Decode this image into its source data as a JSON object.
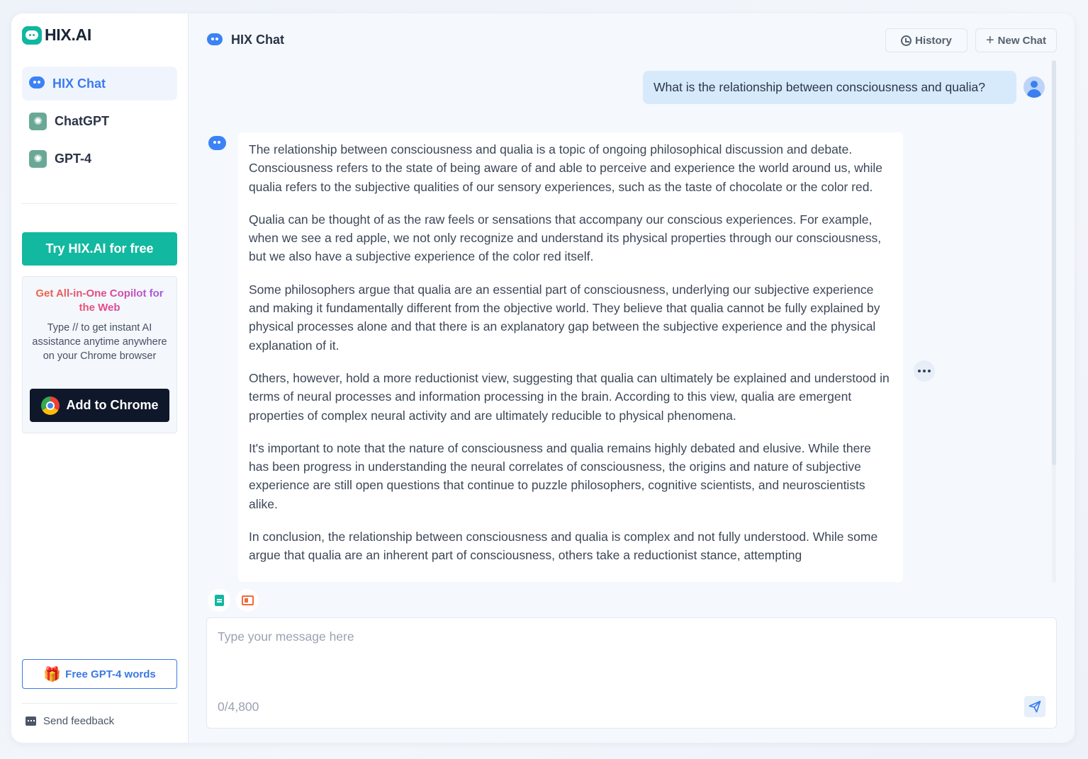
{
  "brand": {
    "name": "HIX.AI"
  },
  "sidebar": {
    "nav": [
      {
        "label": "HIX Chat",
        "icon": "chat-bubble-icon",
        "active": true
      },
      {
        "label": "ChatGPT",
        "icon": "openai-icon",
        "active": false
      },
      {
        "label": "GPT-4",
        "icon": "openai-icon",
        "active": false
      }
    ],
    "try_button": "Try HIX.AI for free",
    "promo": {
      "title": "Get All-in-One Copilot for the Web",
      "text": "Type // to get instant AI assistance anytime anywhere on your Chrome browser",
      "button": "Add to Chrome"
    },
    "free_words_button": "Free GPT-4 words",
    "feedback": "Send feedback"
  },
  "header": {
    "title": "HIX Chat",
    "history_label": "History",
    "new_chat_label": "New Chat"
  },
  "conversation": {
    "user_message": "What is the relationship between consciousness and qualia?",
    "answer_paragraphs": [
      "The relationship between consciousness and qualia is a topic of ongoing philosophical discussion and debate. Consciousness refers to the state of being aware of and able to perceive and experience the world around us, while qualia refers to the subjective qualities of our sensory experiences, such as the taste of chocolate or the color red.",
      "Qualia can be thought of as the raw feels or sensations that accompany our conscious experiences. For example, when we see a red apple, we not only recognize and understand its physical properties through our consciousness, but we also have a subjective experience of the color red itself.",
      "Some philosophers argue that qualia are an essential part of consciousness, underlying our subjective experience and making it fundamentally different from the objective world. They believe that qualia cannot be fully explained by physical processes alone and that there is an explanatory gap between the subjective experience and the physical explanation of it.",
      "Others, however, hold a more reductionist view, suggesting that qualia can ultimately be explained and understood in terms of neural processes and information processing in the brain. According to this view, qualia are emergent properties of complex neural activity and are ultimately reducible to physical phenomena.",
      "It's important to note that the nature of consciousness and qualia remains highly debated and elusive. While there has been progress in understanding the neural correlates of consciousness, the origins and nature of subjective experience are still open questions that continue to puzzle philosophers, cognitive scientists, and neuroscientists alike.",
      "In conclusion, the relationship between consciousness and qualia is complex and not fully understood. While some argue that qualia are an inherent part of consciousness, others take a reductionist stance, attempting"
    ]
  },
  "composer": {
    "placeholder": "Type your message here",
    "value": "",
    "counter": "0/4,800"
  },
  "colors": {
    "accent_teal": "#12b89f",
    "accent_blue": "#3b7df0",
    "user_bubble": "#d6eafb",
    "promo_gradient_start": "#f06a3a",
    "promo_gradient_end": "#9a5cf0"
  }
}
